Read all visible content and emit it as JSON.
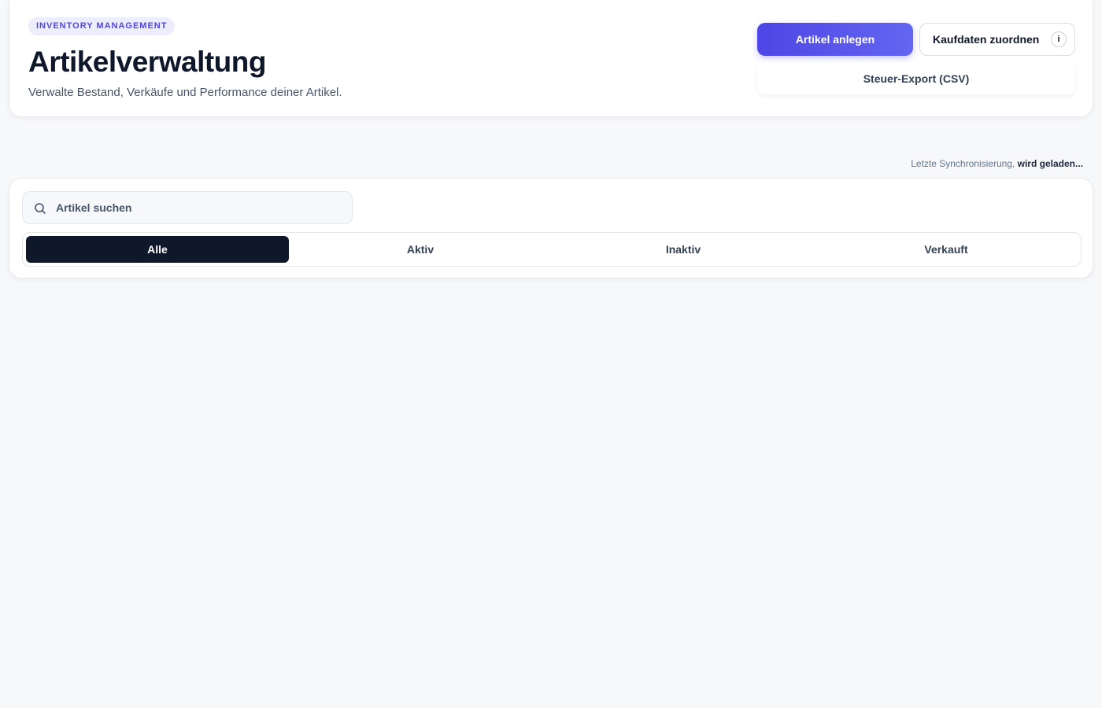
{
  "header": {
    "badge": "INVENTORY MANAGEMENT",
    "title": "Artikelverwaltung",
    "subtitle": "Verwalte Bestand, Verkäufe und Performance deiner Artikel."
  },
  "actions": {
    "create_label": "Artikel anlegen",
    "assign_label": "Kaufdaten zuordnen",
    "info_glyph": "i",
    "export_label": "Steuer-Export (CSV)"
  },
  "sync": {
    "label": "Letzte Synchronisierung,",
    "status": "wird geladen..."
  },
  "search": {
    "placeholder": "Artikel suchen",
    "icon": "search-icon"
  },
  "tabs": [
    {
      "label": "Alle",
      "active": true
    },
    {
      "label": "Aktiv",
      "active": false
    },
    {
      "label": "Inaktiv",
      "active": false
    },
    {
      "label": "Verkauft",
      "active": false
    }
  ],
  "colors": {
    "accent": "#4f46e5",
    "active_tab": "#0f172a",
    "background": "#f7f8fa"
  }
}
